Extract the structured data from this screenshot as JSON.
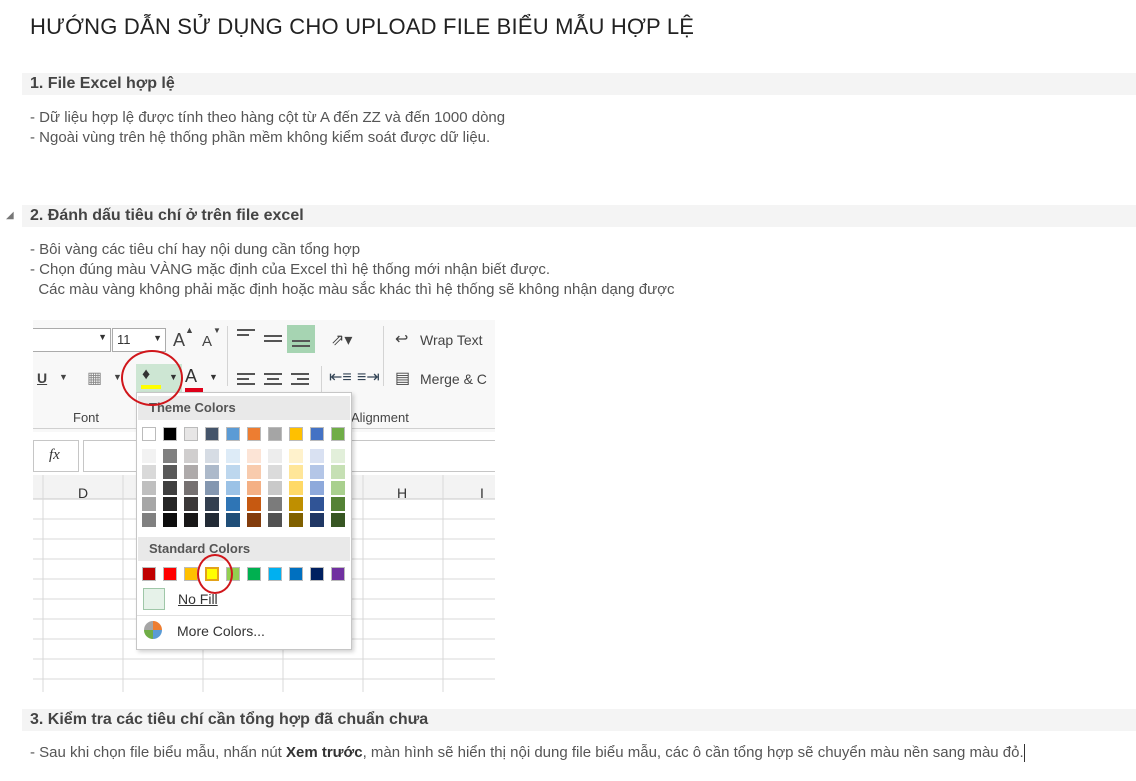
{
  "page": {
    "title": "HƯỚNG DẪN SỬ DỤNG CHO UPLOAD FILE BIỂU MẪU HỢP LỆ"
  },
  "sections": [
    {
      "heading": "1. File Excel hợp lệ",
      "lines": [
        "- Dữ liệu hợp lệ được tính theo hàng cột từ A đến ZZ và đến 1000 dòng",
        "- Ngoài vùng trên hệ thống phần mềm không kiểm soát được dữ liệu."
      ]
    },
    {
      "heading": "2. Đánh dấu tiêu chí ở trên file excel",
      "lines": [
        "- Bôi vàng các tiêu chí hay nội dung cần tổng hợp",
        "- Chọn đúng màu VÀNG mặc định của Excel thì hệ thống mới nhận biết được.",
        "  Các màu vàng không phải mặc định hoặc màu sắc khác thì hệ thống sẽ không nhận dạng được"
      ]
    },
    {
      "heading": "3. Kiểm tra các tiêu chí cần tổng hợp đã chuẩn chưa",
      "line_prefix": "- Sau khi chọn file biểu mẫu, nhấn nút ",
      "line_bold": "Xem trước",
      "line_suffix": ", màn hình sẽ hiển thị nội dung file biểu mẫu, các ô cần tổng hợp sẽ chuyển màu nền sang màu đỏ."
    }
  ],
  "excel": {
    "font_size": "11",
    "grow_font": "A",
    "shrink_font": "A",
    "wrap_text": "Wrap Text",
    "merge": "Merge & C",
    "underline": "U",
    "font_color_letter": "A",
    "group_font": "Font",
    "group_alignment": "Alignment",
    "fx": "fx",
    "col_d": "D",
    "col_h": "H",
    "col_i": "I",
    "icons": [
      "fill-color-icon",
      "font-color-icon",
      "borders-icon",
      "align-top-icon",
      "align-middle-icon",
      "align-bottom-icon",
      "orientation-icon",
      "wrap-text-icon",
      "merge-icon",
      "decrease-indent-icon",
      "increase-indent-icon",
      "align-left-icon",
      "align-center-icon",
      "align-right-icon",
      "more-colors-icon"
    ],
    "palette": {
      "theme_label": "Theme Colors",
      "standard_label": "Standard Colors",
      "no_fill": "No Fill",
      "more_colors": "More Colors...",
      "theme_top": [
        "#FFFFFF",
        "#000000",
        "#E7E6E6",
        "#44546A",
        "#5B9BD5",
        "#ED7D31",
        "#A5A5A5",
        "#FFC000",
        "#4472C4",
        "#70AD47"
      ],
      "theme_shades": [
        [
          "#F2F2F2",
          "#D9D9D9",
          "#BFBFBF",
          "#A6A6A6",
          "#808080"
        ],
        [
          "#808080",
          "#595959",
          "#404040",
          "#262626",
          "#0D0D0D"
        ],
        [
          "#D0CECE",
          "#AEAAAA",
          "#767171",
          "#3B3838",
          "#181717"
        ],
        [
          "#D6DCE4",
          "#ACB9CA",
          "#8497B0",
          "#333F4F",
          "#222A35"
        ],
        [
          "#DDEBF7",
          "#BDD7EE",
          "#9BC2E6",
          "#2F75B5",
          "#1F4E78"
        ],
        [
          "#FCE4D6",
          "#F8CBAD",
          "#F4B084",
          "#C65911",
          "#833C0C"
        ],
        [
          "#EDEDED",
          "#DBDBDB",
          "#C9C9C9",
          "#7B7B7B",
          "#525252"
        ],
        [
          "#FFF2CC",
          "#FFE699",
          "#FFD966",
          "#BF8F00",
          "#806000"
        ],
        [
          "#D9E1F2",
          "#B4C6E7",
          "#8EA9DB",
          "#305496",
          "#203764"
        ],
        [
          "#E2EFDA",
          "#C6E0B4",
          "#A9D08E",
          "#548235",
          "#375623"
        ]
      ],
      "standard": [
        "#C00000",
        "#FF0000",
        "#FFC000",
        "#FFFF00",
        "#92D050",
        "#00B050",
        "#00B0F0",
        "#0070C0",
        "#002060",
        "#7030A0"
      ]
    }
  }
}
